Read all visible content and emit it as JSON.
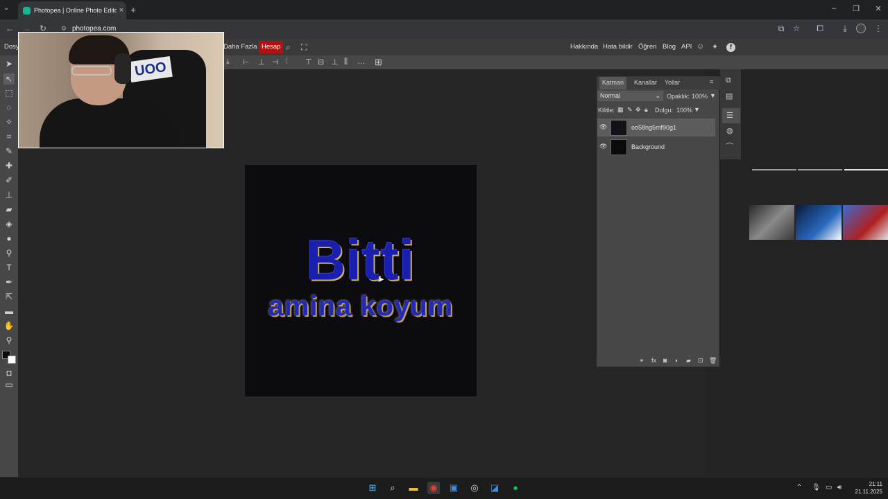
{
  "browser": {
    "tab_title": "Photopea | Online Photo Editor",
    "url": "photopea.com",
    "new_tab": "+",
    "close": "×"
  },
  "menu": {
    "file": "Dosy",
    "more": "Daha Fazla",
    "account": "Hesap",
    "right_links": [
      "Hakkında",
      "Hata bildir",
      "Öğren",
      "Blog",
      "API"
    ]
  },
  "canvas": {
    "title_line": "Bitti",
    "sub_line": "amina koyum"
  },
  "layers_panel": {
    "tabs": [
      "Katman",
      "Kanallar",
      "Yollar"
    ],
    "blend_mode": "Normal",
    "opacity_label": "Opaklık:",
    "opacity_value": "100%",
    "lock_label": "Kilitle:",
    "fill_label": "Dolgu:",
    "fill_value": "100%",
    "layers": [
      {
        "name": "oo58ng5mf90g1",
        "selected": true
      },
      {
        "name": "Background",
        "selected": false
      }
    ]
  },
  "webcam": {
    "logo_text": "UOO"
  },
  "taskbar": {
    "time": "21:11",
    "date": "21.11.2025"
  },
  "colors": {
    "accent_red": "#b31212",
    "panel": "#474747",
    "canvas_bg": "#262626"
  }
}
